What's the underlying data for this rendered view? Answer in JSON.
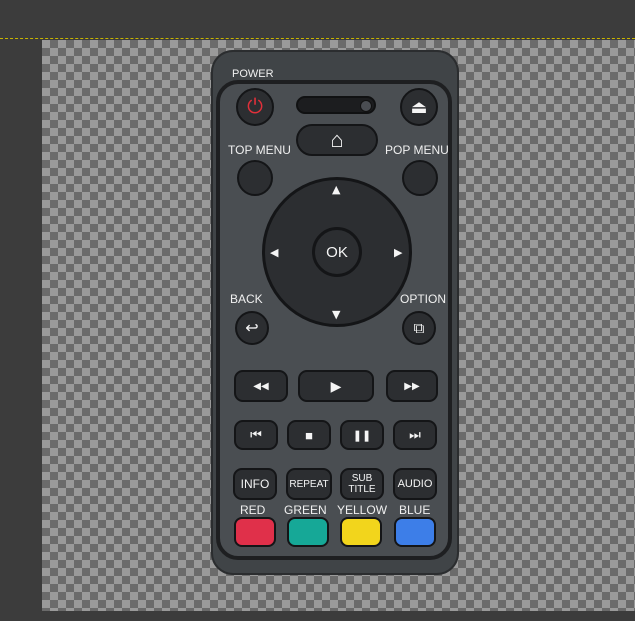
{
  "remote": {
    "labels": {
      "power": "POWER",
      "top_menu": "TOP MENU",
      "pop_menu": "POP MENU",
      "back": "BACK",
      "option": "OPTION",
      "red": "RED",
      "green": "GREEN",
      "yellow": "YELLOW",
      "blue": "BLUE"
    },
    "ok": "OK",
    "buttons": {
      "info": "INFO",
      "repeat": "REPEAT",
      "subtitle_line1": "SUB",
      "subtitle_line2": "TITLE",
      "audio": "AUDIO"
    },
    "symbols": {
      "power": "⏻",
      "eject": "⏏",
      "home": "⌂",
      "up": "▲",
      "down": "▼",
      "left": "◀",
      "right": "▶",
      "back": "↩",
      "option": "⧉",
      "rewind": "◀◀",
      "play": "▶",
      "forward": "▶▶",
      "prev": "⏮",
      "stop": "■",
      "pause": "❚❚",
      "next": "⏭"
    },
    "colors": {
      "red": "#e0304a",
      "green": "#16a897",
      "yellow": "#f2d51c",
      "blue": "#3d7ee8",
      "power_symbol": "#e0303a"
    }
  }
}
